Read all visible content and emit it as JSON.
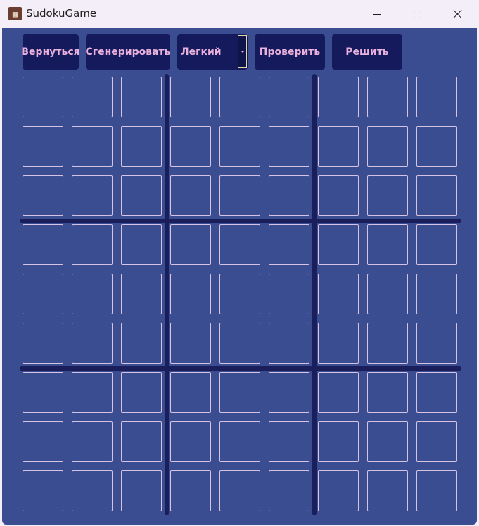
{
  "window": {
    "title": "SudokuGame",
    "icon_name": "sudoku-app-icon",
    "icon_glyph": "▦",
    "min_icon": "minimize-icon",
    "max_icon": "maximize-icon",
    "close_icon": "close-icon"
  },
  "toolbar": {
    "back_label": "Вернуться",
    "generate_label": "Сгенерировать",
    "difficulty_selected": "Легкий",
    "check_label": "Проверить",
    "solve_label": "Решить"
  },
  "board": {
    "cells": [
      [
        "",
        "",
        "",
        "",
        "",
        "",
        "",
        "",
        ""
      ],
      [
        "",
        "",
        "",
        "",
        "",
        "",
        "",
        "",
        ""
      ],
      [
        "",
        "",
        "",
        "",
        "",
        "",
        "",
        "",
        ""
      ],
      [
        "",
        "",
        "",
        "",
        "",
        "",
        "",
        "",
        ""
      ],
      [
        "",
        "",
        "",
        "",
        "",
        "",
        "",
        "",
        ""
      ],
      [
        "",
        "",
        "",
        "",
        "",
        "",
        "",
        "",
        ""
      ],
      [
        "",
        "",
        "",
        "",
        "",
        "",
        "",
        "",
        ""
      ],
      [
        "",
        "",
        "",
        "",
        "",
        "",
        "",
        "",
        ""
      ],
      [
        "",
        "",
        "",
        "",
        "",
        "",
        "",
        "",
        ""
      ]
    ]
  },
  "colors": {
    "background": "#3b4d91",
    "button": "#141a5c",
    "button_text": "#e9b1dc",
    "cell_border": "#d6c2e3",
    "block_divider": "#1a1e5a"
  }
}
